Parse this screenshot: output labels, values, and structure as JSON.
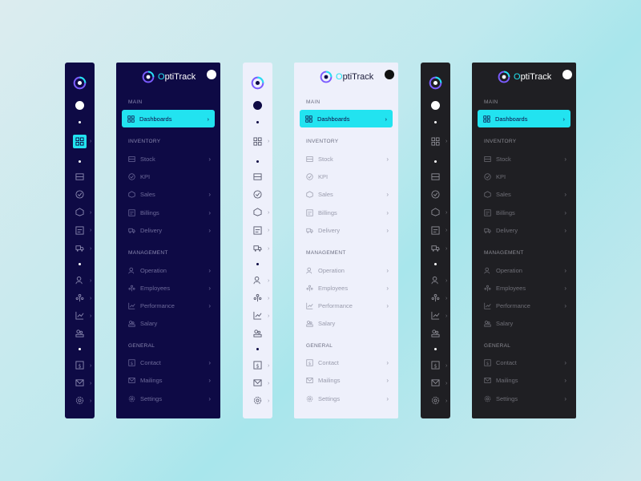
{
  "brand": {
    "first_letter": "O",
    "rest": "ptiTrack"
  },
  "sections": {
    "main": "MAIN",
    "inventory": "INVENTORY",
    "management": "MANAGEMENT",
    "general": "GENERAL"
  },
  "items": {
    "dashboards": "Dashboards",
    "stock": "Stock",
    "kpi": "KPI",
    "sales": "Sales",
    "billings": "Billings",
    "delivery": "Delivery",
    "operation": "Operation",
    "employees": "Employees",
    "performance": "Performance",
    "salary": "Salary",
    "contact": "Contact",
    "mailings": "Mailings",
    "settings": "Settings"
  },
  "chevron": "›",
  "colors": {
    "accent": "#22e3f0",
    "navy": "#0e0a45",
    "light": "#eef0fb",
    "dark": "#1f1f23"
  },
  "icons": [
    "dashboard-icon",
    "stock-icon",
    "kpi-icon",
    "sales-icon",
    "billings-icon",
    "delivery-icon",
    "operation-icon",
    "employees-icon",
    "performance-icon",
    "salary-icon",
    "contact-icon",
    "mailings-icon",
    "settings-icon"
  ]
}
